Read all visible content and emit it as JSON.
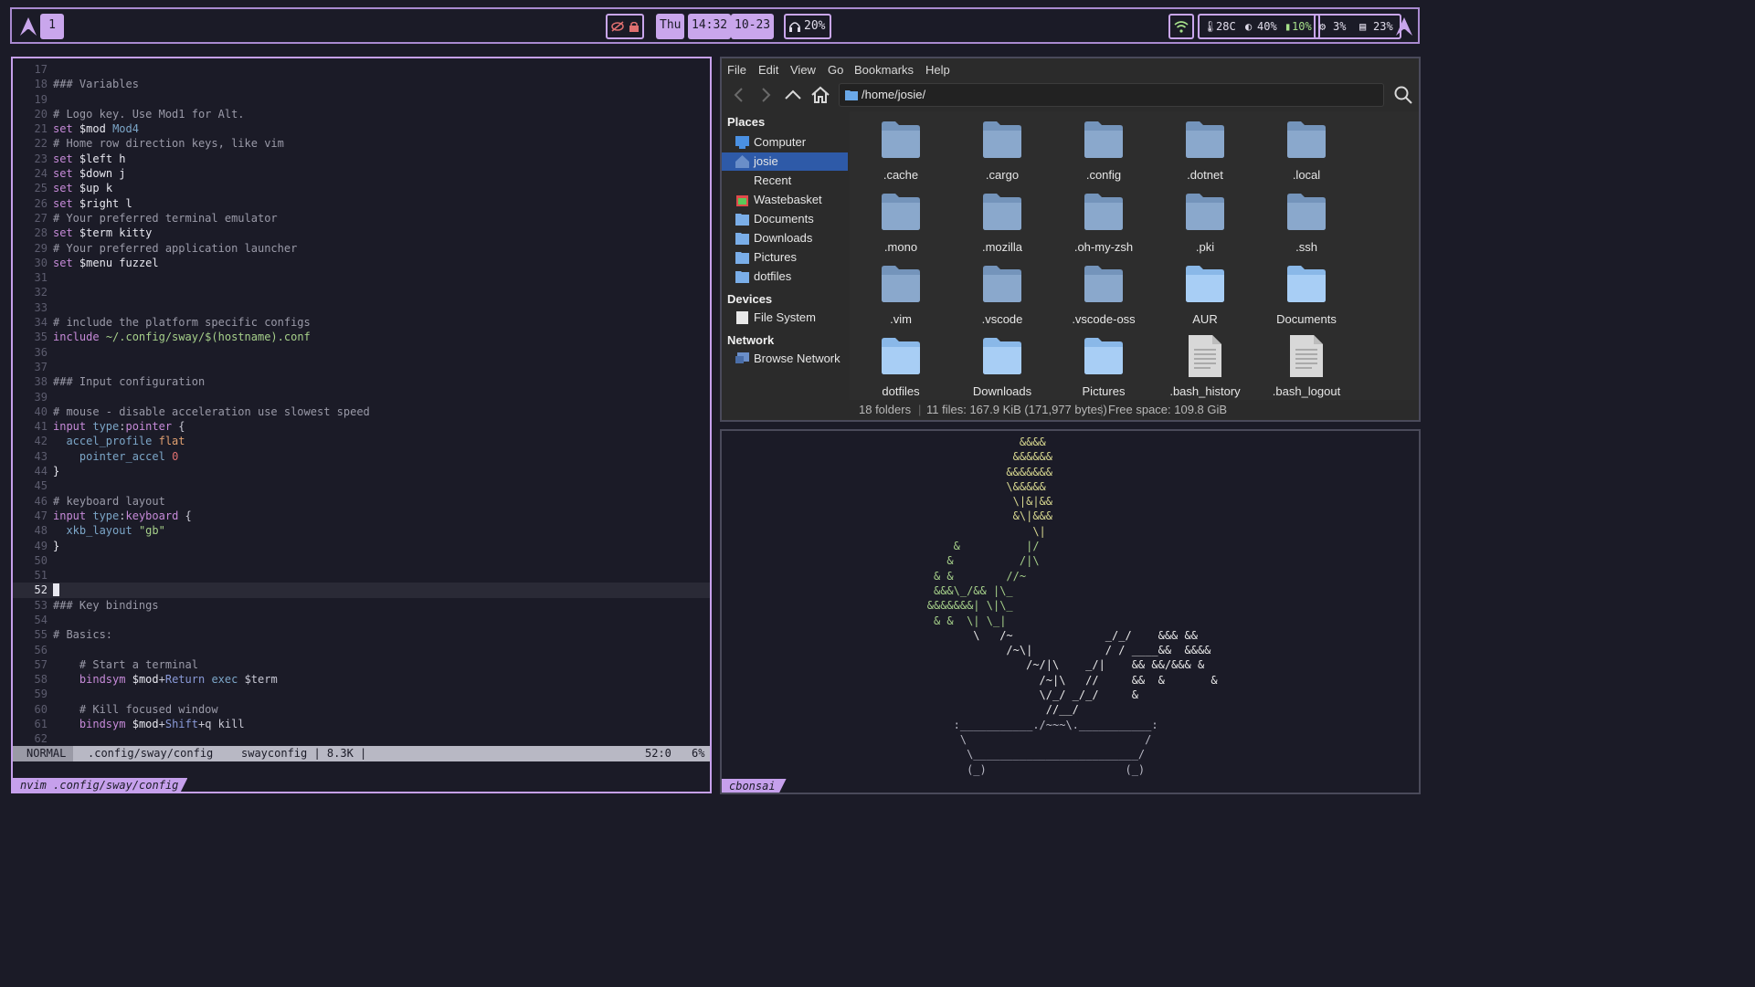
{
  "bar": {
    "workspace": "1",
    "day": "Thu",
    "time": "14:32",
    "date": "10-23",
    "headphones_level": "20%",
    "temperature": "28C",
    "brightness": "40%",
    "battery": "10%",
    "cpu": "3%",
    "memory": "23%",
    "icons": [
      "arch-logo-icon",
      "eye-off-icon",
      "lock-icon",
      "headphones-icon",
      "wifi-icon",
      "thermometer-icon",
      "brightness-icon",
      "battery-icon",
      "cpu-icon",
      "memory-icon"
    ]
  },
  "nvim": {
    "lines": [
      {
        "n": "17",
        "t": ""
      },
      {
        "n": "18",
        "t": "### Variables"
      },
      {
        "n": "19",
        "t": ""
      },
      {
        "n": "20",
        "t": "# Logo key. Use Mod1 for Alt."
      },
      {
        "n": "21",
        "t": "set $mod Mod4"
      },
      {
        "n": "22",
        "t": "# Home row direction keys, like vim"
      },
      {
        "n": "23",
        "t": "set $left h"
      },
      {
        "n": "24",
        "t": "set $down j"
      },
      {
        "n": "25",
        "t": "set $up k"
      },
      {
        "n": "26",
        "t": "set $right l"
      },
      {
        "n": "27",
        "t": "# Your preferred terminal emulator"
      },
      {
        "n": "28",
        "t": "set $term kitty"
      },
      {
        "n": "29",
        "t": "# Your preferred application launcher"
      },
      {
        "n": "30",
        "t": "set $menu fuzzel"
      },
      {
        "n": "31",
        "t": ""
      },
      {
        "n": "32",
        "t": ""
      },
      {
        "n": "33",
        "t": ""
      },
      {
        "n": "34",
        "t": "# include the platform specific configs"
      },
      {
        "n": "35",
        "t": "include ~/.config/sway/$(hostname).conf"
      },
      {
        "n": "36",
        "t": ""
      },
      {
        "n": "37",
        "t": ""
      },
      {
        "n": "38",
        "t": "### Input configuration"
      },
      {
        "n": "39",
        "t": ""
      },
      {
        "n": "40",
        "t": "# mouse - disable acceleration use slowest speed"
      },
      {
        "n": "41",
        "t": "input type:pointer {"
      },
      {
        "n": "42",
        "t": "  accel_profile flat"
      },
      {
        "n": "43",
        "t": "    pointer_accel 0"
      },
      {
        "n": "44",
        "t": "}"
      },
      {
        "n": "45",
        "t": ""
      },
      {
        "n": "46",
        "t": "# keyboard layout"
      },
      {
        "n": "47",
        "t": "input type:keyboard {"
      },
      {
        "n": "48",
        "t": "  xkb_layout \"gb\""
      },
      {
        "n": "49",
        "t": "}"
      },
      {
        "n": "50",
        "t": ""
      },
      {
        "n": "51",
        "t": ""
      },
      {
        "n": "52",
        "t": ""
      },
      {
        "n": "53",
        "t": "### Key bindings"
      },
      {
        "n": "54",
        "t": ""
      },
      {
        "n": "55",
        "t": "# Basics:"
      },
      {
        "n": "56",
        "t": ""
      },
      {
        "n": "57",
        "t": "    # Start a terminal"
      },
      {
        "n": "58",
        "t": "    bindsym $mod+Return exec $term"
      },
      {
        "n": "59",
        "t": ""
      },
      {
        "n": "60",
        "t": "    # Kill focused window"
      },
      {
        "n": "61",
        "t": "    bindsym $mod+Shift+q kill"
      },
      {
        "n": "62",
        "t": ""
      }
    ],
    "cursor_line": "52",
    "status": {
      "mode": "NORMAL",
      "file": ".config/sway/config",
      "info": "swayconfig | 8.3K |",
      "position": "52:0",
      "percent": "6%"
    },
    "window_title": "nvim .config/sway/config"
  },
  "filemanager": {
    "menu": [
      "File",
      "Edit",
      "View",
      "Go",
      "Bookmarks",
      "Help"
    ],
    "location": "/home/josie/",
    "sidebar": {
      "places_header": "Places",
      "places": [
        "Computer",
        "josie",
        "Recent",
        "Wastebasket",
        "Documents",
        "Downloads",
        "Pictures",
        "dotfiles"
      ],
      "devices_header": "Devices",
      "devices": [
        "File System"
      ],
      "network_header": "Network",
      "network": [
        "Browse Network"
      ]
    },
    "items": [
      {
        "name": ".cache",
        "kind": "folder-dim"
      },
      {
        "name": ".cargo",
        "kind": "folder-dim"
      },
      {
        "name": ".config",
        "kind": "folder-dim"
      },
      {
        "name": ".dotnet",
        "kind": "folder-dim"
      },
      {
        "name": ".local",
        "kind": "folder-dim"
      },
      {
        "name": ".mono",
        "kind": "folder-dim"
      },
      {
        "name": ".mozilla",
        "kind": "folder-dim"
      },
      {
        "name": ".oh-my-zsh",
        "kind": "folder-dim"
      },
      {
        "name": ".pki",
        "kind": "folder-dim"
      },
      {
        "name": ".ssh",
        "kind": "folder-dim"
      },
      {
        "name": ".vim",
        "kind": "folder-dim"
      },
      {
        "name": ".vscode",
        "kind": "folder-dim"
      },
      {
        "name": ".vscode-oss",
        "kind": "folder-dim"
      },
      {
        "name": "AUR",
        "kind": "folder"
      },
      {
        "name": "Documents",
        "kind": "folder"
      },
      {
        "name": "dotfiles",
        "kind": "folder"
      },
      {
        "name": "Downloads",
        "kind": "folder"
      },
      {
        "name": "Pictures",
        "kind": "folder"
      },
      {
        "name": ".bash_history",
        "kind": "file"
      },
      {
        "name": ".bash_logout",
        "kind": "file"
      }
    ],
    "status": {
      "folders": "18 folders",
      "files": "11 files: 167.9 KiB (171,977 bytes)",
      "free": "Free space: 109.8 GiB"
    }
  },
  "bonsai": {
    "window_title": "cbonsai",
    "art": [
      {
        "t": "                                            &&&&",
        "c": "g1"
      },
      {
        "t": "                                           &&&&&&",
        "c": "g1"
      },
      {
        "t": "                                          &&&&&&&",
        "c": "g1"
      },
      {
        "t": "                                          \\&&&&&",
        "c": "g1"
      },
      {
        "t": "                                           \\|&|&&",
        "c": "g1"
      },
      {
        "t": "                                           &\\|&&&",
        "c": "g1"
      },
      {
        "t": "                                              \\|",
        "c": "g1"
      },
      {
        "t": "                                  &          |/",
        "c": "g2"
      },
      {
        "t": "                                 &          /|\\",
        "c": "g2"
      },
      {
        "t": "                               & &        //~",
        "c": "g2"
      },
      {
        "t": "                               &&&\\_/&& |\\_",
        "c": "g2"
      },
      {
        "t": "                              &&&&&&&| \\|\\_",
        "c": "g2"
      },
      {
        "t": "                               & &  \\| \\_|",
        "c": "g2"
      },
      {
        "t": "                                     \\   /~              _/_/    &&& &&",
        "c": "tr"
      },
      {
        "t": "                                          /~\\|           / / ____&&  &&&&",
        "c": "tr"
      },
      {
        "t": "                                             /~/|\\    _/|    && &&/&&& &",
        "c": "tr"
      },
      {
        "t": "                                               /~|\\   //     &&  &       &",
        "c": "tr"
      },
      {
        "t": "                                               \\/_/ _/_/     &",
        "c": "tr"
      },
      {
        "t": "                                                //__/",
        "c": "tr"
      },
      {
        "t": "                                  :___________./~~~\\.___________:",
        "c": "pot"
      },
      {
        "t": "                                   \\                           /",
        "c": "pot"
      },
      {
        "t": "                                    \\_________________________/",
        "c": "pot"
      },
      {
        "t": "                                    (_)                     (_)",
        "c": "pot"
      }
    ]
  }
}
